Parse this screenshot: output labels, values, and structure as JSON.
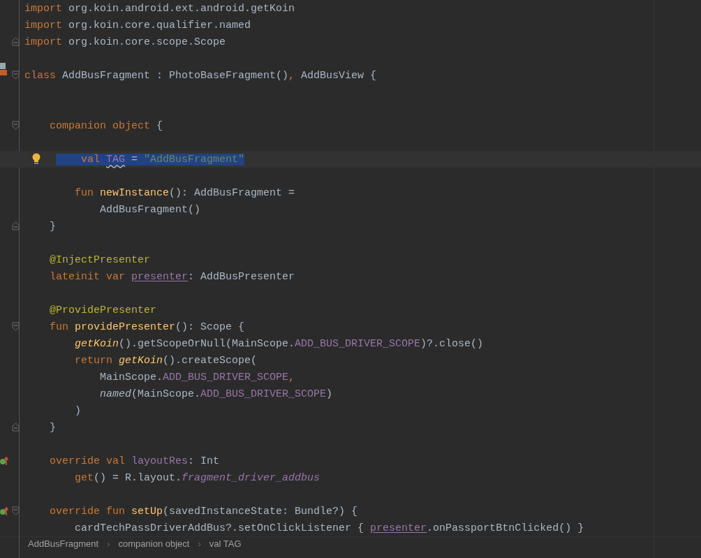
{
  "editor": {
    "lines": [
      {
        "kind": "code",
        "tokens": [
          {
            "kind": "kw",
            "text": "import "
          },
          {
            "kind": "plain",
            "text": "org.koin.android.ext.android.getKoin"
          }
        ]
      },
      {
        "kind": "code",
        "tokens": [
          {
            "kind": "kw",
            "text": "import "
          },
          {
            "kind": "plain",
            "text": "org.koin.core.qualifier.named"
          }
        ]
      },
      {
        "kind": "code",
        "fold_end": true,
        "tokens": [
          {
            "kind": "kw",
            "text": "import "
          },
          {
            "kind": "plain",
            "text": "org.koin.core.scope.Scope"
          }
        ]
      },
      {
        "kind": "blank"
      },
      {
        "kind": "code",
        "fold_start": true,
        "class_marker": true,
        "tokens": [
          {
            "kind": "kw",
            "text": "class "
          },
          {
            "kind": "plain",
            "text": "AddBusFragment : PhotoBaseFragment()"
          },
          {
            "kind": "kw",
            "text": ", "
          },
          {
            "kind": "plain",
            "text": "AddBusView {"
          }
        ]
      },
      {
        "kind": "blank"
      },
      {
        "kind": "blank"
      },
      {
        "kind": "code",
        "fold_start": true,
        "tokens": [
          {
            "kind": "kw",
            "text": "    companion object "
          },
          {
            "kind": "plain",
            "text": "{"
          }
        ]
      },
      {
        "kind": "blank"
      },
      {
        "kind": "code",
        "current": true,
        "bulb": true,
        "tokens": [
          {
            "kind": "kw",
            "text": "        val "
          },
          {
            "kind": "propWavy",
            "text": "TAG"
          },
          {
            "kind": "plain",
            "text": " = "
          },
          {
            "kind": "str",
            "text": "\"AddBusFragment\""
          }
        ]
      },
      {
        "kind": "blank"
      },
      {
        "kind": "code",
        "tokens": [
          {
            "kind": "kw",
            "text": "        fun "
          },
          {
            "kind": "fn",
            "text": "newInstance"
          },
          {
            "kind": "plain",
            "text": "(): AddBusFragment ="
          }
        ]
      },
      {
        "kind": "code",
        "tokens": [
          {
            "kind": "plain",
            "text": "            AddBusFragment()"
          }
        ]
      },
      {
        "kind": "code",
        "fold_end": true,
        "tokens": [
          {
            "kind": "plain",
            "text": "    }"
          }
        ]
      },
      {
        "kind": "blank"
      },
      {
        "kind": "code",
        "tokens": [
          {
            "kind": "annot",
            "text": "    @InjectPresenter"
          }
        ]
      },
      {
        "kind": "code",
        "tokens": [
          {
            "kind": "kw",
            "text": "    lateinit var "
          },
          {
            "kind": "propLink",
            "text": "presenter"
          },
          {
            "kind": "plain",
            "text": ": AddBusPresenter"
          }
        ]
      },
      {
        "kind": "blank"
      },
      {
        "kind": "code",
        "tokens": [
          {
            "kind": "annot",
            "text": "    @ProvidePresenter"
          }
        ]
      },
      {
        "kind": "code",
        "fold_start": true,
        "tokens": [
          {
            "kind": "kw",
            "text": "    fun "
          },
          {
            "kind": "fn",
            "text": "providePresenter"
          },
          {
            "kind": "plain",
            "text": "(): Scope {"
          }
        ]
      },
      {
        "kind": "code",
        "tokens": [
          {
            "kind": "fnItalic",
            "text": "        getKoin"
          },
          {
            "kind": "plain",
            "text": "().getScopeOrNull(MainScope."
          },
          {
            "kind": "prop",
            "text": "ADD_BUS_DRIVER_SCOPE"
          },
          {
            "kind": "plain",
            "text": ")?.close()"
          }
        ]
      },
      {
        "kind": "code",
        "tokens": [
          {
            "kind": "kw",
            "text": "        return "
          },
          {
            "kind": "fnItalic",
            "text": "getKoin"
          },
          {
            "kind": "plain",
            "text": "().createScope("
          }
        ]
      },
      {
        "kind": "code",
        "tokens": [
          {
            "kind": "plain",
            "text": "            MainScope."
          },
          {
            "kind": "prop",
            "text": "ADD_BUS_DRIVER_SCOPE"
          },
          {
            "kind": "kw",
            "text": ","
          }
        ]
      },
      {
        "kind": "code",
        "tokens": [
          {
            "kind": "plainItalic",
            "text": "            named"
          },
          {
            "kind": "plain",
            "text": "(MainScope."
          },
          {
            "kind": "prop",
            "text": "ADD_BUS_DRIVER_SCOPE"
          },
          {
            "kind": "plain",
            "text": ")"
          }
        ]
      },
      {
        "kind": "code",
        "tokens": [
          {
            "kind": "plain",
            "text": "        )"
          }
        ]
      },
      {
        "kind": "code",
        "fold_end": true,
        "tokens": [
          {
            "kind": "plain",
            "text": "    }"
          }
        ]
      },
      {
        "kind": "blank"
      },
      {
        "kind": "code",
        "override_marker": true,
        "tokens": [
          {
            "kind": "kw",
            "text": "    override val "
          },
          {
            "kind": "prop",
            "text": "layoutRes"
          },
          {
            "kind": "plain",
            "text": ": Int"
          }
        ]
      },
      {
        "kind": "code",
        "tokens": [
          {
            "kind": "kw",
            "text": "        get"
          },
          {
            "kind": "plain",
            "text": "() = R.layout."
          },
          {
            "kind": "propItalic",
            "text": "fragment_driver_addbus"
          }
        ]
      },
      {
        "kind": "blank"
      },
      {
        "kind": "code",
        "fold_start": true,
        "override_marker": true,
        "tokens": [
          {
            "kind": "kw",
            "text": "    override fun "
          },
          {
            "kind": "fn",
            "text": "setUp"
          },
          {
            "kind": "plain",
            "text": "(savedInstanceState: Bundle?) {"
          }
        ]
      },
      {
        "kind": "code",
        "tokens": [
          {
            "kind": "plain",
            "text": "        cardTechPassDriverAddBus?.setOnClickListener { "
          },
          {
            "kind": "propLink",
            "text": "presenter"
          },
          {
            "kind": "plain",
            "text": ".onPassportBtnClicked() }"
          }
        ]
      }
    ]
  },
  "breadcrumbs": [
    {
      "kind": "item",
      "text": "AddBusFragment"
    },
    {
      "kind": "separator",
      "text": "›"
    },
    {
      "kind": "item",
      "text": "companion object"
    },
    {
      "kind": "separator",
      "text": "›"
    },
    {
      "kind": "item",
      "text": "val TAG"
    }
  ]
}
